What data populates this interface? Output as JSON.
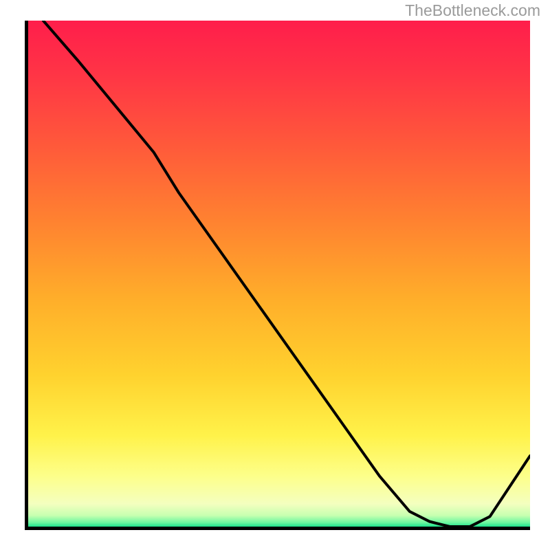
{
  "attribution": "TheBottleneck.com",
  "marker_text": "",
  "chart_data": {
    "type": "line",
    "title": "",
    "xlabel": "",
    "ylabel": "",
    "xlim": [
      0,
      100
    ],
    "ylim": [
      0,
      100
    ],
    "grid": false,
    "legend": false,
    "series": [
      {
        "name": "curve",
        "x": [
          3,
          10,
          20,
          25,
          30,
          40,
          50,
          60,
          70,
          76,
          80,
          84,
          88,
          92,
          100
        ],
        "y": [
          100,
          92,
          80,
          74,
          66,
          52,
          38,
          24,
          10,
          3,
          1,
          0,
          0,
          2,
          14
        ]
      }
    ],
    "gradient_stops": [
      {
        "offset": 0.0,
        "color": "#ff1e4b"
      },
      {
        "offset": 0.1,
        "color": "#ff3346"
      },
      {
        "offset": 0.25,
        "color": "#ff5a3a"
      },
      {
        "offset": 0.4,
        "color": "#ff8330"
      },
      {
        "offset": 0.55,
        "color": "#ffae2a"
      },
      {
        "offset": 0.7,
        "color": "#ffd22e"
      },
      {
        "offset": 0.82,
        "color": "#fff24a"
      },
      {
        "offset": 0.9,
        "color": "#fdff8a"
      },
      {
        "offset": 0.955,
        "color": "#f4ffbf"
      },
      {
        "offset": 0.978,
        "color": "#c7ffb0"
      },
      {
        "offset": 0.992,
        "color": "#6cf7a0"
      },
      {
        "offset": 1.0,
        "color": "#1de28d"
      }
    ],
    "marker": {
      "x": 85,
      "y": 0.5
    }
  }
}
